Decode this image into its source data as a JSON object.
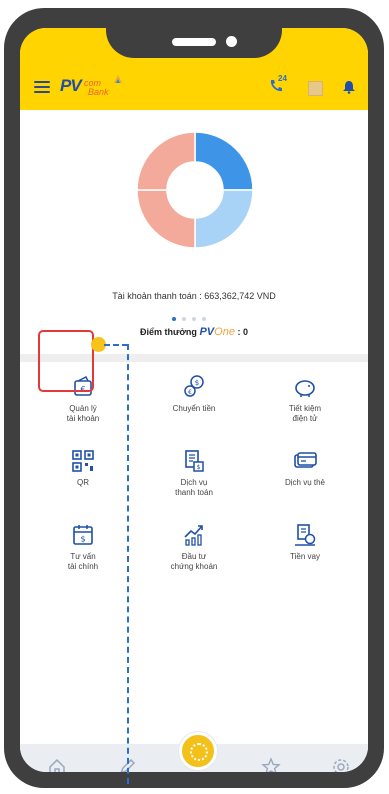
{
  "header": {
    "logo_main": "PV",
    "logo_sub_top": "com",
    "logo_sub_bottom": "Bank",
    "hotline_badge": "24",
    "icons": [
      "menu-icon",
      "hotline-icon",
      "gift-icon",
      "bell-icon"
    ]
  },
  "account": {
    "balance_line": "Tài khoản thanh toán : 663,362,742 VND",
    "carousel_page": 1,
    "carousel_total": 4
  },
  "points": {
    "label": "Điểm thưởng",
    "brand_pv": "PV",
    "brand_one": "One",
    "value": ": 0"
  },
  "chart_data": {
    "type": "pie",
    "values": [
      25,
      25,
      25,
      25
    ],
    "colors": [
      "#3e95e8",
      "#a9d2f7",
      "#f4aa9a",
      "#f4aa9a"
    ]
  },
  "services": [
    {
      "label": "Quản lý\ntài khoản",
      "icon": "wallet-icon"
    },
    {
      "label": "Chuyển tiền",
      "icon": "money-transfer-icon"
    },
    {
      "label": "Tiết kiệm\nđiện tử",
      "icon": "piggy-bank-icon"
    },
    {
      "label": "QR",
      "icon": "qr-code-icon"
    },
    {
      "label": "Dịch vụ\nthanh toán",
      "icon": "payment-service-icon"
    },
    {
      "label": "Dịch vụ thẻ",
      "icon": "card-service-icon"
    },
    {
      "label": "Tư vấn\ntài chính",
      "icon": "calendar-finance-icon"
    },
    {
      "label": "Đầu tư\nchứng khoán",
      "icon": "stock-investment-icon"
    },
    {
      "label": "Tiền vay",
      "icon": "loan-icon"
    }
  ],
  "bottom_nav": [
    "home-icon",
    "edit-icon",
    "center-action-icon",
    "star-icon",
    "settings-icon"
  ],
  "colors": {
    "brand_yellow": "#ffd400",
    "brand_blue": "#1f4fa8",
    "highlight_red": "#e23a3a",
    "annotation_blue": "#2d6fc7"
  }
}
